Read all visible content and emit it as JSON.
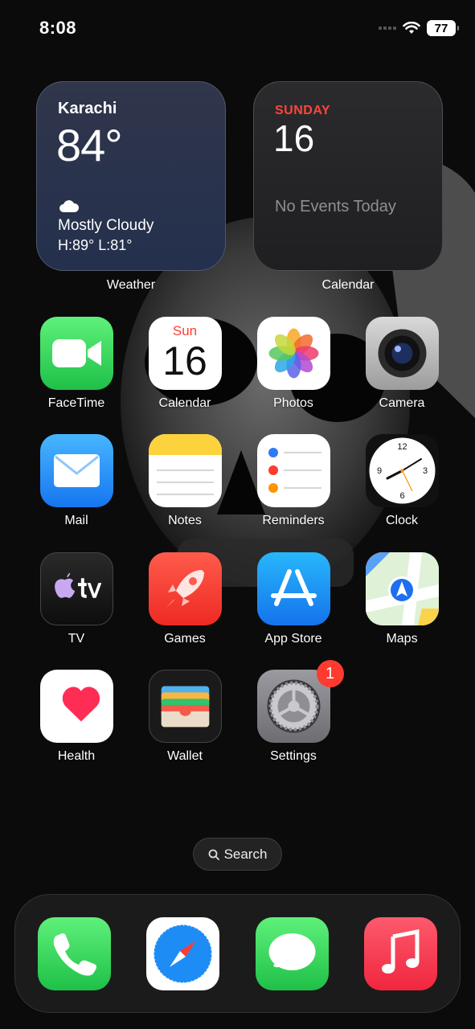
{
  "status": {
    "time": "8:08",
    "battery": "77"
  },
  "widgets": {
    "weather": {
      "city": "Karachi",
      "temp": "84°",
      "condition": "Mostly Cloudy",
      "hilo": "H:89° L:81°",
      "label": "Weather"
    },
    "calendar": {
      "day": "SUNDAY",
      "date": "16",
      "events": "No Events Today",
      "label": "Calendar"
    }
  },
  "apps": {
    "facetime": "FaceTime",
    "calendar": "Calendar",
    "calendar_day": "Sun",
    "calendar_date": "16",
    "photos": "Photos",
    "camera": "Camera",
    "mail": "Mail",
    "notes": "Notes",
    "reminders": "Reminders",
    "clock": "Clock",
    "tv": "TV",
    "games": "Games",
    "appstore": "App Store",
    "maps": "Maps",
    "health": "Health",
    "wallet": "Wallet",
    "settings": "Settings",
    "settings_badge": "1",
    "clock_numbers": {
      "n12": "12",
      "n3": "3",
      "n6": "6",
      "n9": "9"
    }
  },
  "search": {
    "label": "Search"
  },
  "dock": {
    "apps": [
      "Phone",
      "Safari",
      "Messages",
      "Music"
    ]
  },
  "icons": {
    "wifi": "wifi-icon",
    "cellular": "cellular-signal-icon",
    "battery": "battery-icon",
    "cloud": "cloud-icon",
    "search": "search-icon"
  }
}
